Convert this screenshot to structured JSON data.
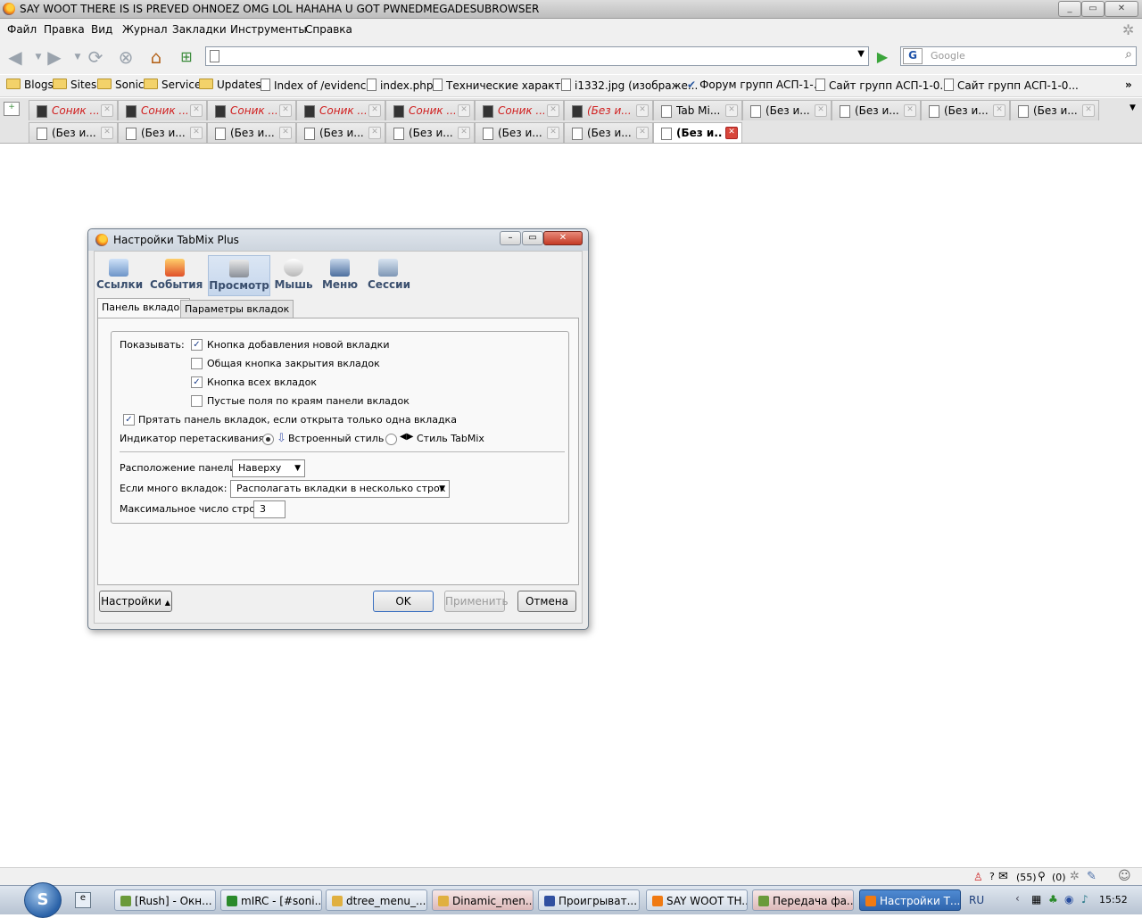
{
  "window": {
    "title": "SAY WOOT THERE IS IS PREVED OHNOEZ OMG LOL  HAHAHA U GOT PWNEDMEGADESUBROWSER"
  },
  "menu": [
    "Файл",
    "Правка",
    "Вид",
    "Журнал",
    "Закладки",
    "Инструменты",
    "Справка"
  ],
  "search": {
    "placeholder": "Google",
    "engine_icon": "google-icon"
  },
  "bookmarks": [
    {
      "label": "Blogs",
      "icon": "folder-icon"
    },
    {
      "label": "Sites",
      "icon": "folder-icon"
    },
    {
      "label": "Sonic",
      "icon": "folder-icon"
    },
    {
      "label": "Service",
      "icon": "folder-icon"
    },
    {
      "label": "Updates",
      "icon": "folder-icon"
    },
    {
      "label": "Index of /evidence",
      "icon": "page-icon"
    },
    {
      "label": "index.php",
      "icon": "page-icon"
    },
    {
      "label": "Технические характ...",
      "icon": "page-icon"
    },
    {
      "label": "i1332.jpg (изображе...",
      "icon": "page-icon"
    },
    {
      "label": "Форум групп АСП-1-...",
      "icon": "check-icon"
    },
    {
      "label": "Сайт групп АСП-1-0...",
      "icon": "page-icon"
    },
    {
      "label": "Сайт групп АСП-1-0...",
      "icon": "page-icon"
    }
  ],
  "tabs_row1": [
    {
      "label": "Соник ...",
      "style": "red"
    },
    {
      "label": "Соник ...",
      "style": "red"
    },
    {
      "label": "Соник ...",
      "style": "red"
    },
    {
      "label": "Соник ...",
      "style": "red"
    },
    {
      "label": "Соник ...",
      "style": "red"
    },
    {
      "label": "Соник ...",
      "style": "red"
    },
    {
      "label": "(Без и...",
      "style": "red"
    },
    {
      "label": "Tab Mi...",
      "style": "normal"
    },
    {
      "label": "(Без и...",
      "style": "normal"
    },
    {
      "label": "(Без и...",
      "style": "normal"
    },
    {
      "label": "(Без и...",
      "style": "normal"
    },
    {
      "label": "(Без и...",
      "style": "normal"
    }
  ],
  "tabs_row2": [
    {
      "label": "(Без и...",
      "style": "normal"
    },
    {
      "label": "(Без и...",
      "style": "normal"
    },
    {
      "label": "(Без и...",
      "style": "normal"
    },
    {
      "label": "(Без и...",
      "style": "normal"
    },
    {
      "label": "(Без и...",
      "style": "normal"
    },
    {
      "label": "(Без и...",
      "style": "normal"
    },
    {
      "label": "(Без и...",
      "style": "normal"
    },
    {
      "label": "(Без и...",
      "style": "active"
    }
  ],
  "dialog": {
    "title": "Настройки TabMix Plus",
    "categories": [
      "Ссылки",
      "События",
      "Просмотр",
      "Мышь",
      "Меню",
      "Сессии"
    ],
    "selected_category": "Просмотр",
    "subtabs": [
      "Панель вкладок",
      "Параметры вкладок"
    ],
    "show_label": "Показывать:",
    "options": [
      {
        "label": "Кнопка добавления новой вкладки",
        "checked": "✓"
      },
      {
        "label": "Общая кнопка закрытия вкладок",
        "checked": ""
      },
      {
        "label": "Кнопка всех вкладок",
        "checked": "✓"
      },
      {
        "label": "Пустые поля по краям панели вкладок",
        "checked": ""
      }
    ],
    "hide_single": {
      "label": "Прятать панель вкладок, если открыта только одна вкладка",
      "checked": "✓"
    },
    "drag_label": "Индикатор перетаскивания:",
    "drag_builtin": "Встроенный стиль",
    "drag_tabmix": "Стиль TabMix",
    "position_label": "Расположение панели:",
    "position_value": "Наверху",
    "many_label": "Если много вкладок:",
    "many_value": "Располагать вкладки в несколько строк",
    "maxrows_label": "Максимальное число строк:",
    "maxrows_value": "3",
    "settings_button": "Настройки",
    "ok_button": "OK",
    "apply_button": "Применить",
    "cancel_button": "Отмена"
  },
  "status": {
    "mail_count": "(55)",
    "other_count": "(0)",
    "help": "?"
  },
  "taskbar": {
    "start_icon": "start-orb-icon",
    "items": [
      {
        "label": "[Rush] - Окн..."
      },
      {
        "label": "mIRC - [#soni..."
      },
      {
        "label": "dtree_menu_..."
      },
      {
        "label": "Dinamic_men..."
      },
      {
        "label": "Проигрыват..."
      },
      {
        "label": "SAY WOOT TH..."
      },
      {
        "label": "Передача фа..."
      },
      {
        "label": "Настройки Т..."
      }
    ],
    "lang": "RU",
    "clock": "15:52"
  }
}
